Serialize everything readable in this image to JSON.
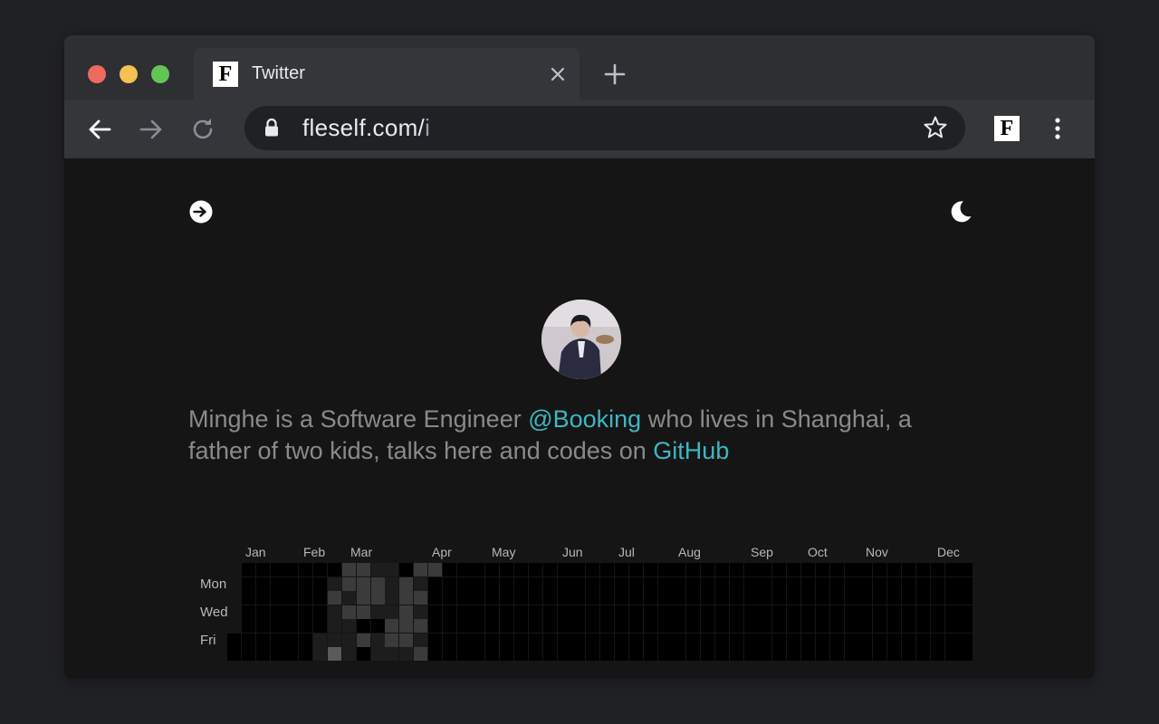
{
  "browser": {
    "tab_title": "Twitter",
    "favicon_letter": "F",
    "url_host": "fleself.com/",
    "url_path": "i",
    "extension_letter": "F"
  },
  "page": {
    "bio_part1": "Minghe is a Software Engineer ",
    "bio_link1": "@Booking",
    "bio_part2": " who lives in Shanghai, a father of two kids, talks here and codes on ",
    "bio_link2": "GitHub"
  },
  "contributions": {
    "months": [
      "Jan",
      "Feb",
      "Mar",
      "Apr",
      "May",
      "Jun",
      "Jul",
      "Aug",
      "Sep",
      "Oct",
      "Nov",
      "Dec"
    ],
    "day_labels": [
      "Mon",
      "Wed",
      "Fri"
    ],
    "weeks": 52,
    "first_week_start_day": 5,
    "levels": [
      [],
      [],
      [],
      [],
      [],
      [],
      [
        0,
        0,
        0,
        0,
        0,
        1,
        1
      ],
      [
        0,
        1,
        2,
        1,
        1,
        1,
        3
      ],
      [
        2,
        2,
        1,
        2,
        1,
        1,
        1
      ],
      [
        2,
        2,
        2,
        2,
        0,
        2,
        0
      ],
      [
        1,
        2,
        2,
        1,
        0,
        1,
        1
      ],
      [
        1,
        1,
        1,
        1,
        2,
        2,
        1
      ],
      [
        0,
        2,
        2,
        2,
        2,
        2,
        1
      ],
      [
        2,
        1,
        2,
        1,
        2,
        1,
        2
      ],
      [
        2,
        0,
        0,
        0,
        0,
        0,
        0
      ],
      [],
      [],
      [],
      [],
      [],
      [],
      [],
      [],
      [],
      [],
      [],
      [],
      [],
      [],
      [],
      [],
      [],
      [],
      [],
      [],
      [],
      [],
      [],
      [],
      [],
      [],
      [],
      [],
      [],
      [],
      [],
      [],
      [],
      [],
      [],
      [],
      [],
      []
    ],
    "level_colors": [
      "#000000",
      "#1d1d1d",
      "#3b3b3b",
      "#5a5a5a"
    ]
  }
}
